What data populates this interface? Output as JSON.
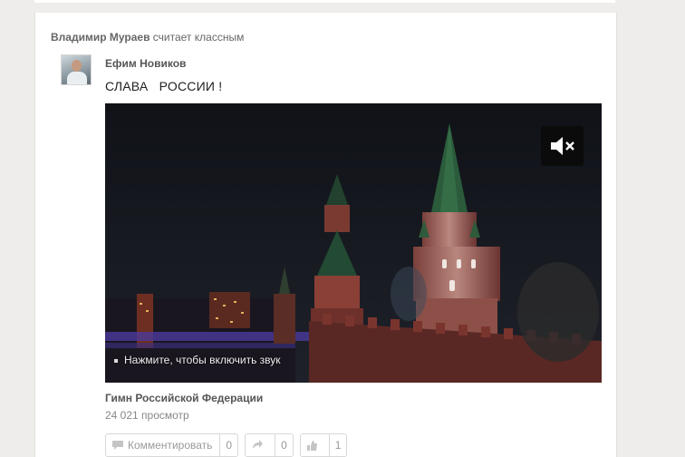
{
  "feed_item": {
    "actor": "Владимир Мураев",
    "action": "считает классным"
  },
  "post": {
    "author": "Ефим Новиков",
    "text": "СЛАВА   РОССИИ !"
  },
  "video": {
    "sound_hint": "Нажмите, чтобы включить звук",
    "title": "Гимн Российской Федерации",
    "views": "24 021  просмотр"
  },
  "actions": {
    "comment_label": "Комментировать",
    "comment_count": "0",
    "share_count": "0",
    "like_count": "1"
  },
  "icons": [
    "speaker-muted-icon",
    "comment-icon",
    "share-icon",
    "like-icon"
  ],
  "colors": {
    "page_bg": "#efedeb",
    "card_bg": "#ffffff",
    "video_bg": "#15171c"
  }
}
